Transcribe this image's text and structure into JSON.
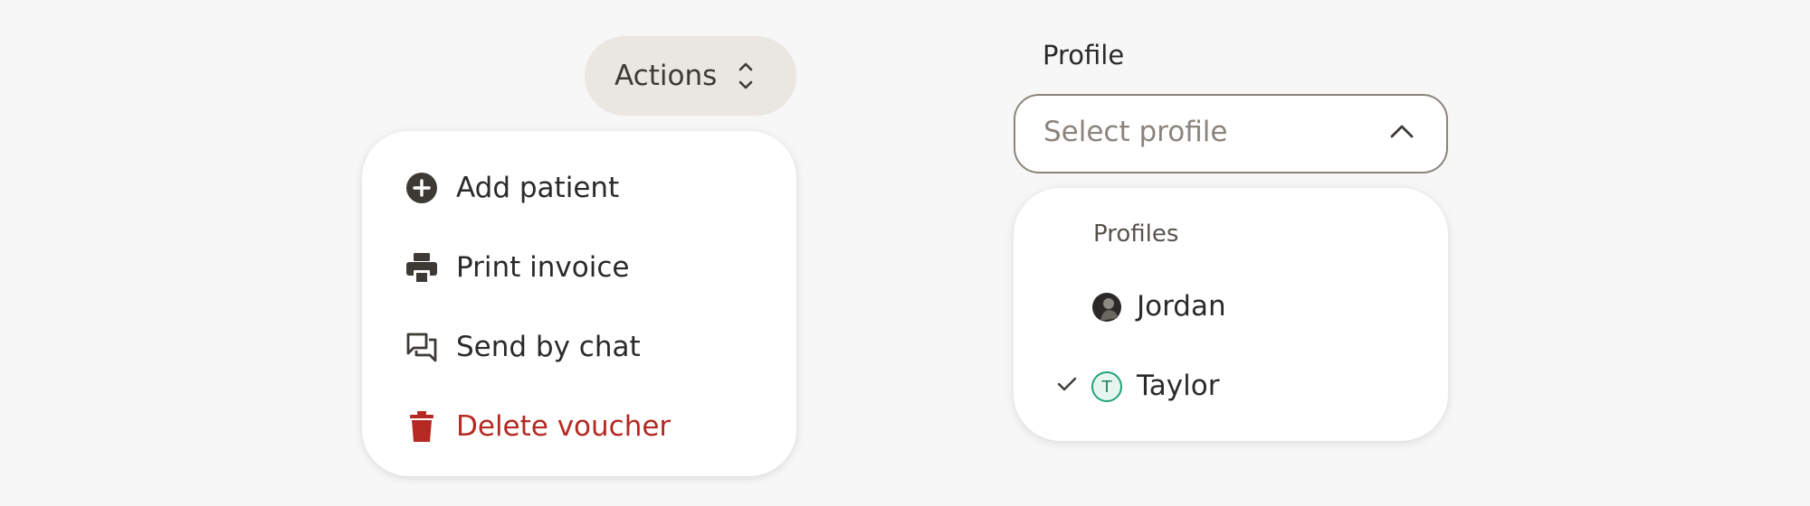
{
  "actions": {
    "label": "Actions",
    "menu": [
      {
        "label": "Add patient",
        "icon": "add-circle-icon"
      },
      {
        "label": "Print invoice",
        "icon": "printer-icon"
      },
      {
        "label": "Send by chat",
        "icon": "chat-icon"
      },
      {
        "label": "Delete voucher",
        "icon": "trash-icon",
        "color": "#b42a22"
      }
    ]
  },
  "profile": {
    "label": "Profile",
    "placeholder": "Select profile",
    "group_label": "Profiles",
    "options": [
      {
        "label": "Jordan",
        "avatar": "photo-avatar",
        "selected": false
      },
      {
        "label": "Taylor",
        "avatar_initial": "T",
        "selected": true
      }
    ]
  },
  "colors": {
    "background": "#f6f7f6",
    "danger": "#b42a22",
    "avatar_accent": "#1fa37a",
    "pill": "#eae7e3"
  }
}
